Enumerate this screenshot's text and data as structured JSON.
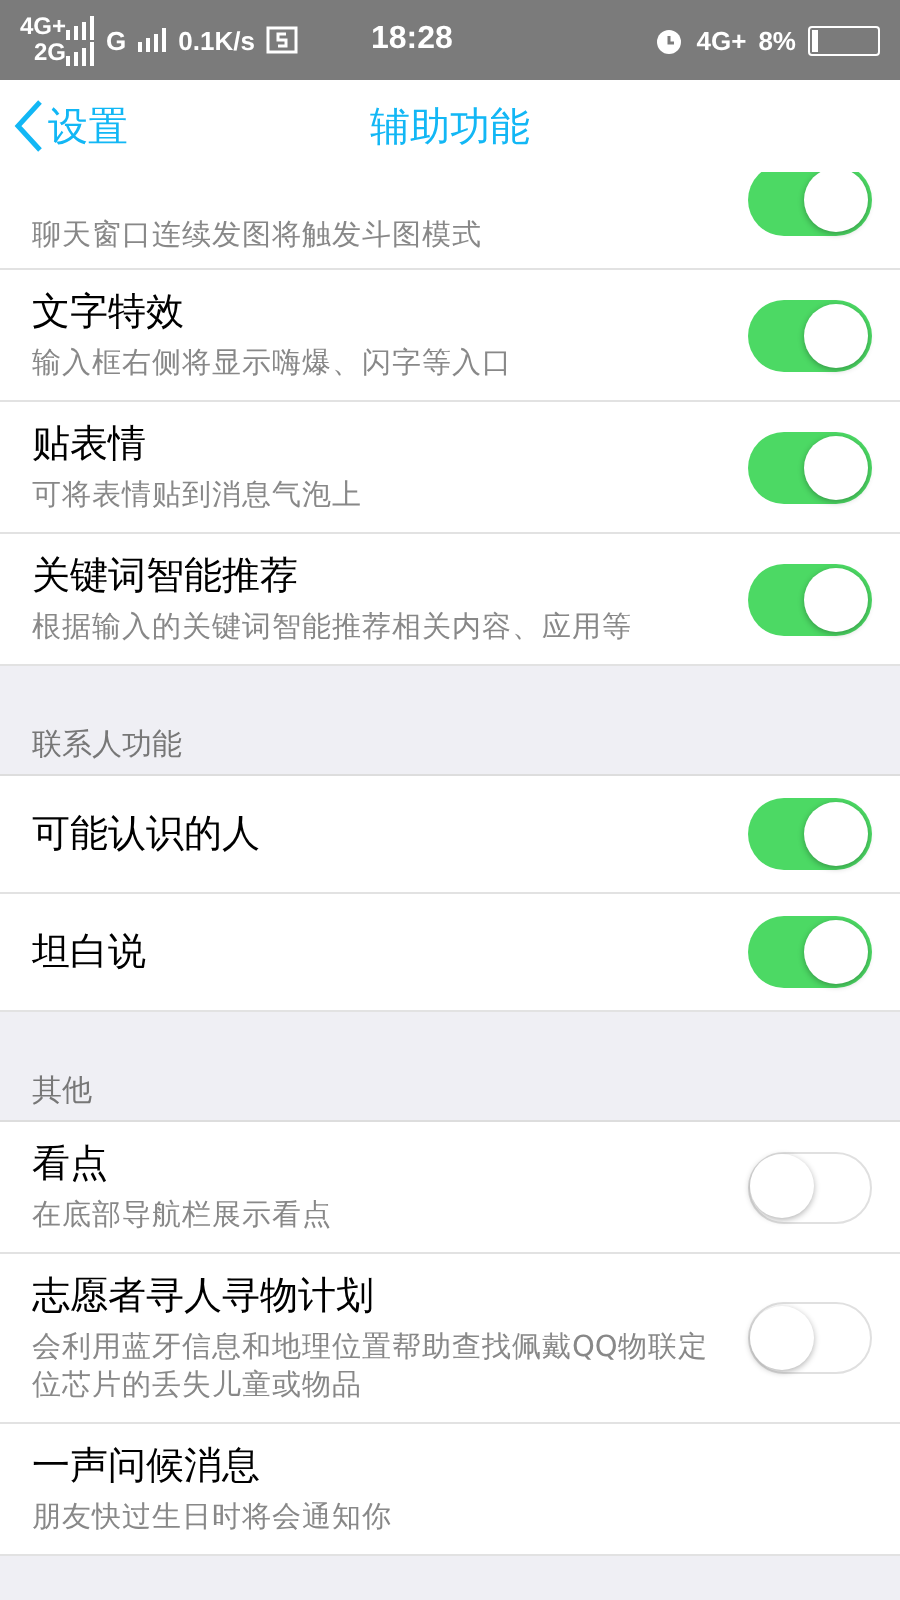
{
  "status_bar": {
    "network_1": "4G+",
    "network_2": "2G",
    "network_3": "G",
    "speed": "0.1K/s",
    "time": "18:28",
    "network_4": "4G+",
    "battery": "8%"
  },
  "nav": {
    "back": "设置",
    "title": "辅助功能"
  },
  "sections": [
    {
      "rows": [
        {
          "kind": "cut",
          "subtitle": "聊天窗口连续发图将触发斗图模式",
          "on": true
        },
        {
          "kind": "toggle",
          "title": "文字特效",
          "subtitle": "输入框右侧将显示嗨爆、闪字等入口",
          "on": true
        },
        {
          "kind": "toggle",
          "title": "贴表情",
          "subtitle": "可将表情贴到消息气泡上",
          "on": true
        },
        {
          "kind": "toggle",
          "title": "关键词智能推荐",
          "subtitle": "根据输入的关键词智能推荐相关内容、应用等",
          "on": true
        }
      ]
    },
    {
      "header": "联系人功能",
      "rows": [
        {
          "kind": "toggle",
          "title": "可能认识的人",
          "on": true
        },
        {
          "kind": "toggle",
          "title": "坦白说",
          "on": true
        }
      ]
    },
    {
      "header": "其他",
      "rows": [
        {
          "kind": "toggle",
          "title": "看点",
          "subtitle": "在底部导航栏展示看点",
          "on": false
        },
        {
          "kind": "toggle",
          "title": "志愿者寻人寻物计划",
          "subtitle": "会利用蓝牙信息和地理位置帮助查找佩戴QQ物联定位芯片的丢失儿童或物品",
          "on": false
        },
        {
          "kind": "plain",
          "title": "一声问候消息",
          "subtitle": "朋友快过生日时将会通知你"
        }
      ]
    }
  ]
}
